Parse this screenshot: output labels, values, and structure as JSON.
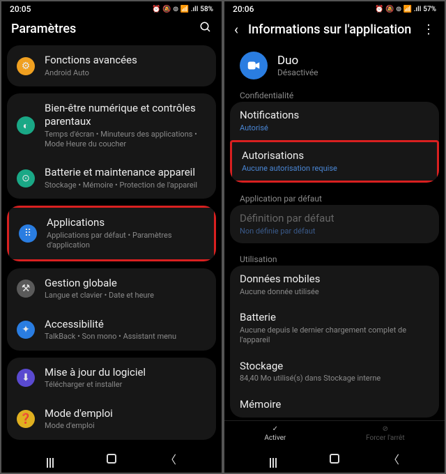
{
  "left": {
    "status": {
      "time": "20:05",
      "battery": "58%",
      "indicators": "⏰ 🔕 ⊚ 📶 .ıll"
    },
    "header": {
      "title": "Paramètres"
    },
    "items": [
      {
        "title": "Fonctions avancées",
        "sub": "Android Auto"
      },
      {
        "title": "Bien-être numérique et contrôles parentaux",
        "sub": "Temps d'écran • Minuteurs des applications • Mode Heure du coucher"
      },
      {
        "title": "Batterie et maintenance appareil",
        "sub": "Stockage • Mémoire • Protection de l'appareil"
      },
      {
        "title": "Applications",
        "sub": "Applications par défaut • Paramètres d'application"
      },
      {
        "title": "Gestion globale",
        "sub": "Langue et clavier • Date et heure"
      },
      {
        "title": "Accessibilité",
        "sub": "TalkBack • Son mono • Assistant menu"
      },
      {
        "title": "Mise à jour du logiciel",
        "sub": "Télécharger et installer"
      },
      {
        "title": "Mode d'emploi",
        "sub": "Mode d'emploi"
      }
    ]
  },
  "right": {
    "status": {
      "time": "20:06",
      "battery": "57%",
      "indicators": "⏰ 🔕 ⊚ 📶 .ıll"
    },
    "header": {
      "title": "Informations sur l'application"
    },
    "app": {
      "name": "Duo",
      "status": "Désactivée"
    },
    "sections": {
      "privacy": "Confidentialité",
      "default": "Application par défaut",
      "usage": "Utilisation"
    },
    "privacy_items": [
      {
        "title": "Notifications",
        "sub": "Autorisé"
      },
      {
        "title": "Autorisations",
        "sub": "Aucune autorisation requise"
      }
    ],
    "default_item": {
      "title": "Définition par défaut",
      "sub": "Non définie par défaut"
    },
    "usage_items": [
      {
        "title": "Données mobiles",
        "sub": "Aucune donnée utilisée"
      },
      {
        "title": "Batterie",
        "sub": "Aucune depuis le dernier chargement complet de l'appareil"
      },
      {
        "title": "Stockage",
        "sub": "84,40 Mo utilisé(s) dans Stockage interne"
      },
      {
        "title": "Mémoire",
        "sub": ""
      }
    ],
    "actions": {
      "activate": "Activer",
      "force_stop": "Forcer l'arrêt"
    }
  }
}
